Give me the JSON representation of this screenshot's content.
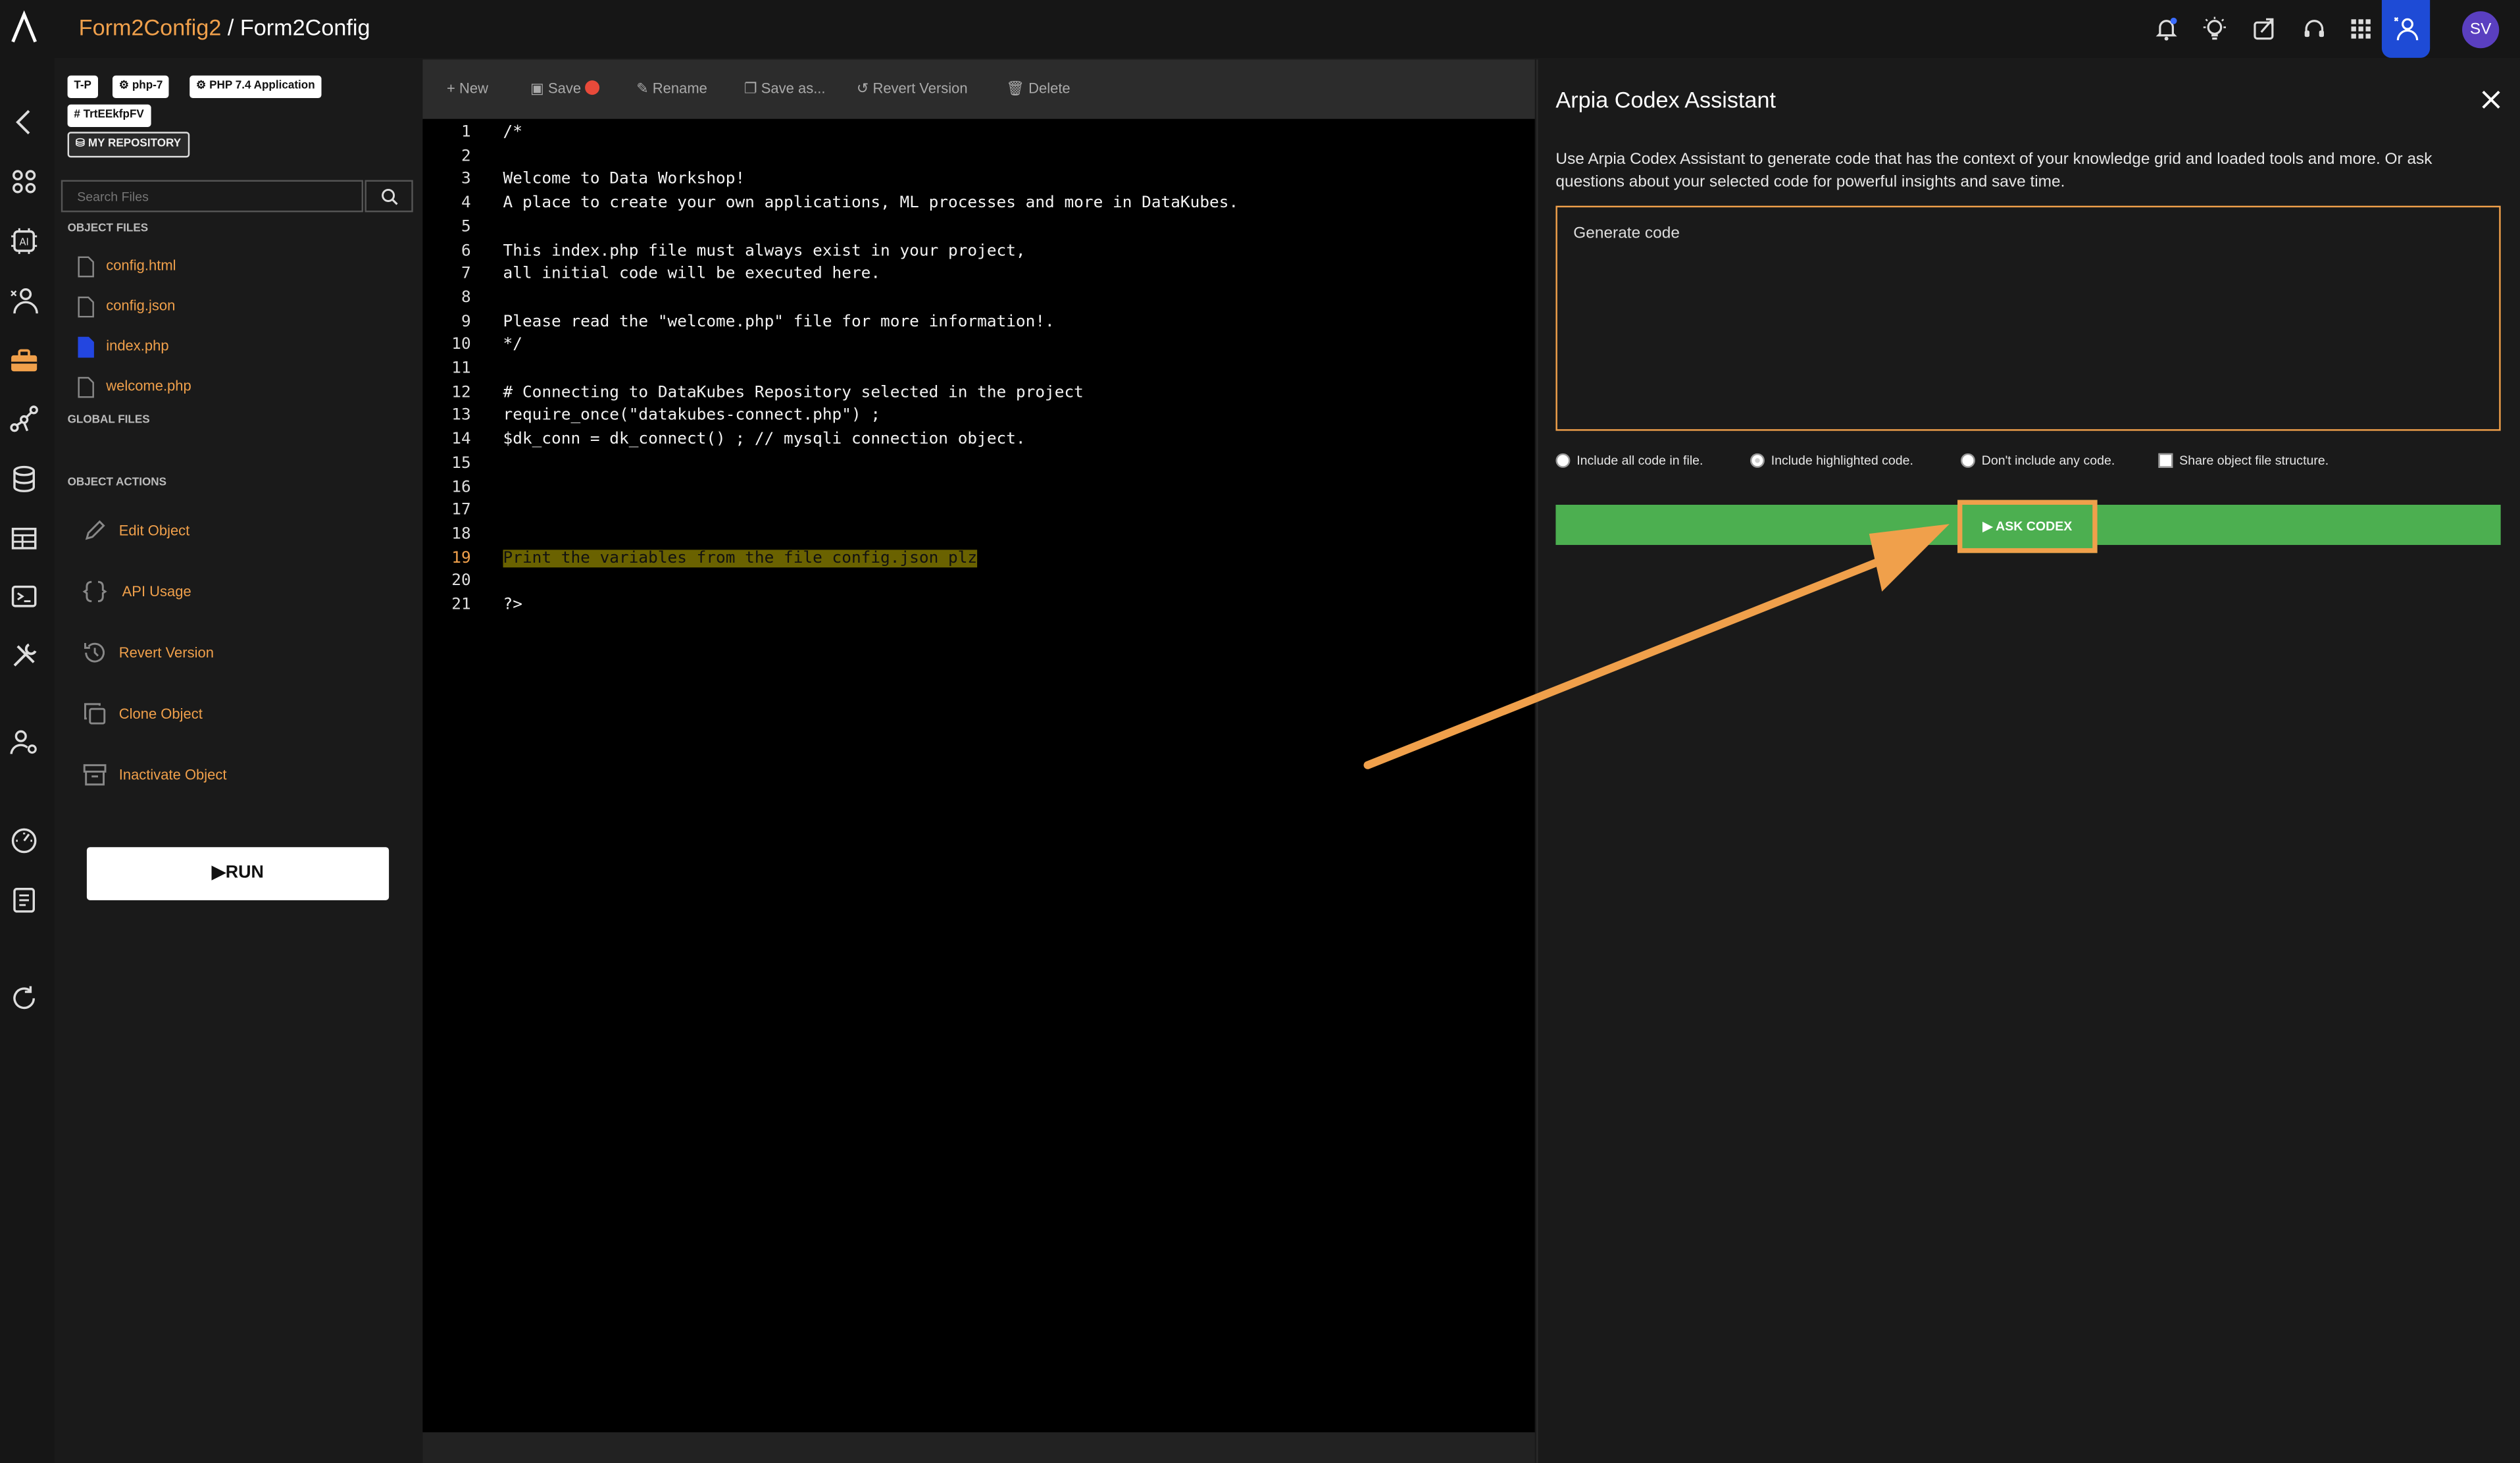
{
  "header": {
    "project": "Form2Config2",
    "separator": " / ",
    "object": "Form2Config",
    "avatar_initials": "SV"
  },
  "tags": {
    "t1": "T-P",
    "t2": "php-7",
    "t3": "PHP 7.4 Application",
    "t4": "TrtEEkfpFV",
    "repo": "MY REPOSITORY"
  },
  "search": {
    "placeholder": "Search Files"
  },
  "sections": {
    "object_files": "OBJECT FILES",
    "global_files": "GLOBAL FILES",
    "object_actions": "OBJECT ACTIONS"
  },
  "files": [
    "config.html",
    "config.json",
    "index.php",
    "welcome.php"
  ],
  "actions": [
    "Edit Object",
    "API Usage",
    "Revert Version",
    "Clone Object",
    "Inactivate Object"
  ],
  "run_label": "RUN",
  "toolbar": {
    "new": "New",
    "save": "Save",
    "rename": "Rename",
    "save_as": "Save as...",
    "revert": "Revert Version",
    "delete": "Delete"
  },
  "code_lines": [
    "/*",
    "",
    "Welcome to Data Workshop!",
    "A place to create your own applications, ML processes and more in DataKubes.",
    "",
    "This index.php file must always exist in your project,",
    "all initial code will be executed here.",
    "",
    "Please read the \"welcome.php\" file for more information!.",
    "*/",
    "",
    "# Connecting to DataKubes Repository selected in the project",
    "require_once(\"datakubes-connect.php\") ;",
    "$dk_conn = dk_connect() ; // mysqli connection object.",
    "",
    "",
    "",
    "",
    "Print the variables from the file config.json plz",
    "",
    "?>"
  ],
  "codex": {
    "title": "Arpia Codex Assistant",
    "description": "Use Arpia Codex Assistant to generate code that has the context of your knowledge grid and loaded tools and more. Or ask questions about your selected code for powerful insights and save time.",
    "prompt_text": "Generate code",
    "options": [
      "Include all code in file.",
      "Include highlighted code.",
      "Don't include any code.",
      "Share object file structure."
    ],
    "ask_label": "ASK CODEX"
  },
  "colors": {
    "accent_orange": "#f0a04b",
    "ask_green": "#4caf50",
    "user_blue": "#1e4bd6",
    "avatar_purple": "#5a3fc0"
  }
}
